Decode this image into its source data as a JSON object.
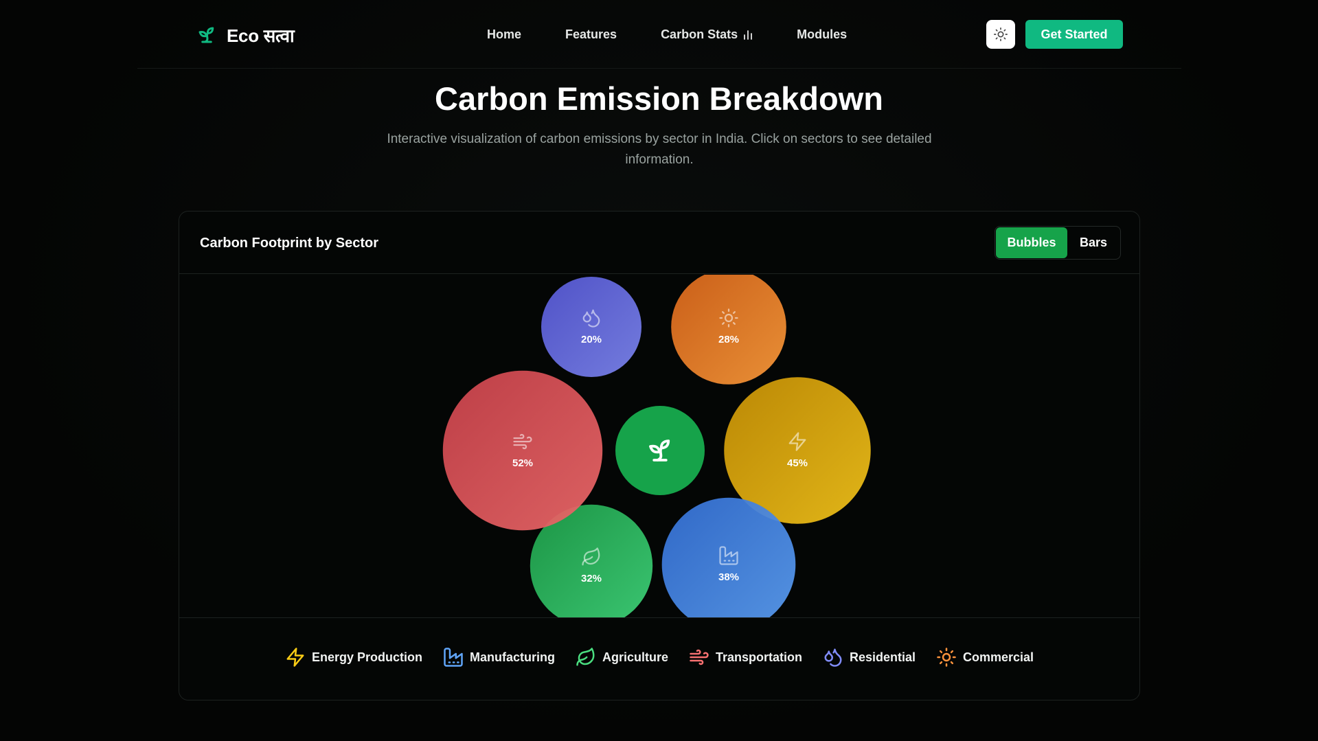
{
  "nav": {
    "brand": "Eco सत्वा",
    "links": [
      "Home",
      "Features",
      "Carbon Stats",
      "Modules"
    ],
    "cta": "Get Started"
  },
  "hero": {
    "title": "Carbon Emission Breakdown",
    "subtitle": "Interactive visualization of carbon emissions by sector in India. Click on sectors to see detailed information."
  },
  "card": {
    "title": "Carbon Footprint by Sector",
    "toggle": {
      "active": "Bubbles",
      "inactive": "Bars"
    }
  },
  "chart_data": {
    "type": "bubble",
    "center_icon": "sprout-icon",
    "series": [
      {
        "name": "Energy Production",
        "value": 45,
        "label": "45%",
        "icon": "lightning-icon",
        "color": "#eab308"
      },
      {
        "name": "Manufacturing",
        "value": 38,
        "label": "38%",
        "icon": "factory-icon",
        "color": "#3b82f6"
      },
      {
        "name": "Agriculture",
        "value": 32,
        "label": "32%",
        "icon": "leaf-icon",
        "color": "#22c55e"
      },
      {
        "name": "Transportation",
        "value": 52,
        "label": "52%",
        "icon": "wind-icon",
        "color": "#ef4444"
      },
      {
        "name": "Residential",
        "value": 20,
        "label": "20%",
        "icon": "droplets-icon",
        "color": "#6366f1"
      },
      {
        "name": "Commercial",
        "value": 28,
        "label": "28%",
        "icon": "sun-icon",
        "color": "#f97316"
      }
    ]
  },
  "legend": {
    "items": [
      {
        "label": "Energy Production",
        "icon": "lightning-icon",
        "color": "#facc15"
      },
      {
        "label": "Manufacturing",
        "icon": "factory-icon",
        "color": "#60a5fa"
      },
      {
        "label": "Agriculture",
        "icon": "leaf-icon",
        "color": "#4ade80"
      },
      {
        "label": "Transportation",
        "icon": "wind-icon",
        "color": "#f87171"
      },
      {
        "label": "Residential",
        "icon": "droplets-icon",
        "color": "#818cf8"
      },
      {
        "label": "Commercial",
        "icon": "sun-icon",
        "color": "#fb923c"
      }
    ]
  }
}
